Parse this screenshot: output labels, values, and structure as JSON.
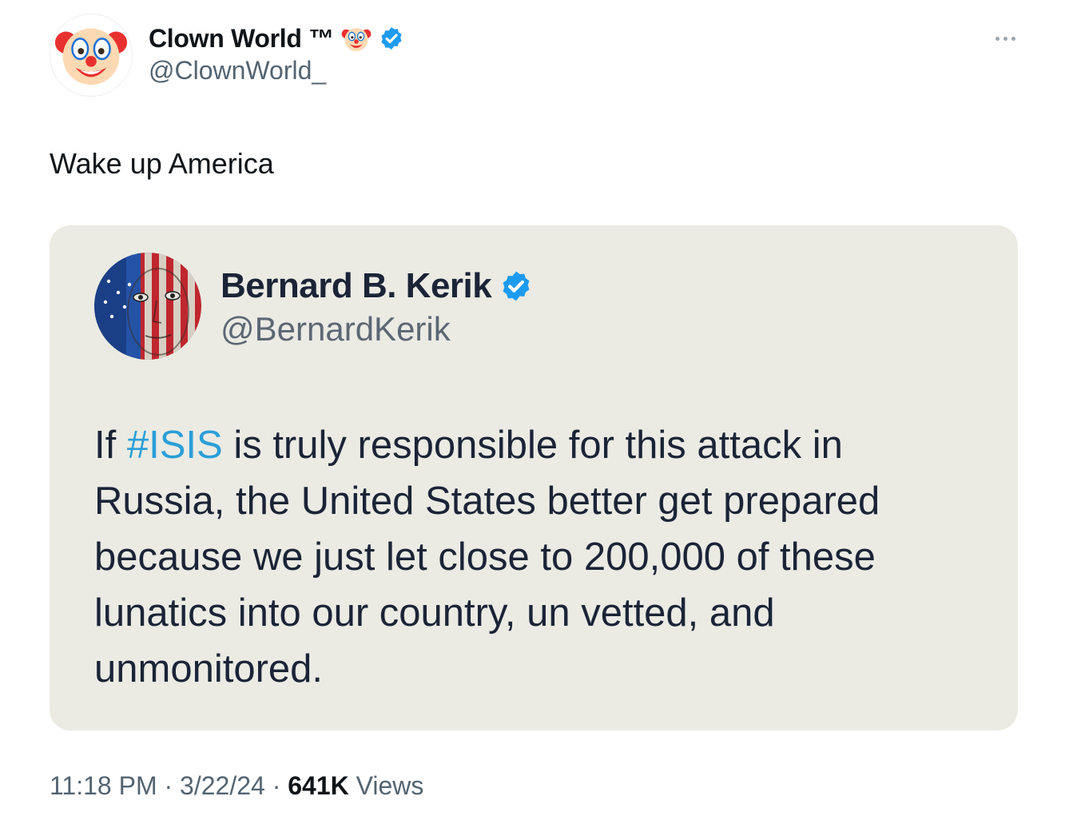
{
  "tweet": {
    "author": {
      "display_name": "Clown World ™",
      "handle": "@ClownWorld_",
      "avatar_icon": "clown-face-icon",
      "name_emoji_icon": "clown-face-icon",
      "verified": true,
      "verified_color": "#1d9bf0"
    },
    "text": "Wake up America",
    "more_icon": "more-horizontal-icon",
    "quoted": {
      "author": {
        "display_name": "Bernard B. Kerik",
        "handle": "@BernardKerik",
        "avatar_icon": "flag-painted-face-avatar",
        "verified": true
      },
      "body_lines": [
        {
          "hashtag_prefix": "If ",
          "hashtag": "#ISIS",
          "rest": " is truly responsible for this attack in"
        },
        {
          "text": "Russia, the United States better get prepared"
        },
        {
          "text": "because we just let close to 200,000 of these"
        },
        {
          "text": "lunatics into our country, un vetted, and"
        },
        {
          "text": "unmonitored."
        }
      ],
      "hashtag_color": "#2a9fd8",
      "background": "#ebebe4"
    },
    "meta": {
      "time": "11:18 PM",
      "separator": " · ",
      "date": "3/22/24",
      "views_count": "641K",
      "views_label": " Views"
    }
  }
}
